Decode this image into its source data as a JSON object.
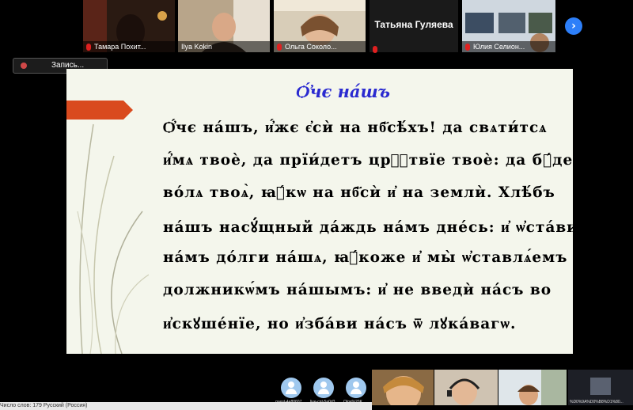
{
  "participants_top": [
    {
      "name": "Тамара Похит..."
    },
    {
      "name": "Ilya Kokin"
    },
    {
      "name": "Ольга Соколо..."
    },
    {
      "name": "Татьяна Гуляева"
    },
    {
      "name": "Юлия Селион..."
    }
  ],
  "recording": {
    "label": "Запись..."
  },
  "slide": {
    "title": "Ѻ҆́чє на́шъ",
    "lines": [
      "Ѻ҆́чє на́шъ, и҆́жє є҆сѝ на нб҃сѣ́хъ! да свѧти́тсѧ",
      "и҆́мѧ твоѐ, да прїи́детъ црⷭ҇твїе твоѐ: да бꙋ́детъ",
      "во́лѧ твоѧ̀, ꙗ҆́кѡ на нб҃сѝ и҆ на землѝ. Хлѣ́бъ",
      "на́шъ насꙋ́щный да́ждь на́мъ дне́сь: и҆ ѡ҆ста́ви",
      "на́мъ до́лги на́шѧ, ꙗ҆́коже и҆ мы̀ ѡ҆ставлѧ́емъ",
      "должникѡ́мъ на́шымъ: и҆ не введѝ на́съ во",
      "и҆скꙋше́нїе, но и҆зба́ви на́съ ѿ лꙋка́вагѡ."
    ]
  },
  "participants_bottom": [
    {
      "name": "guest-4a80607..."
    },
    {
      "name": "live-cnt-5a0d3..."
    },
    {
      "name": "Olga%20K"
    }
  ],
  "last_tile_text": "%D0%9A%D0%B8%D1%80...",
  "status_bar": {
    "text": "Число слов: 179    Русский (Россия)"
  }
}
